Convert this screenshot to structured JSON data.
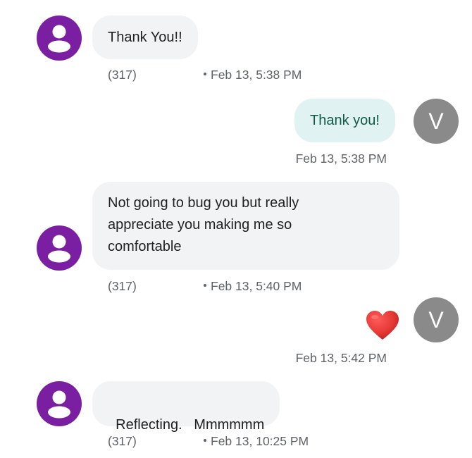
{
  "colors": {
    "incoming_avatar": "#7b1fa2",
    "outgoing_avatar": "#8a8a8a",
    "incoming_bubble": "#f1f3f4",
    "outgoing_bubble": "#e0f2f1",
    "outgoing_text": "#0d5c45",
    "heart": "#e53935"
  },
  "icons": {
    "incoming_avatar": "person-icon",
    "reaction": "heart-icon"
  },
  "messages": [
    {
      "direction": "incoming",
      "text": "Thank You!!",
      "sender": "(317)",
      "timestamp": "Feb 13, 5:38 PM"
    },
    {
      "direction": "outgoing",
      "text": "Thank you!",
      "avatar_letter": "V",
      "timestamp": "Feb 13, 5:38 PM"
    },
    {
      "direction": "incoming",
      "lines": [
        "Not going to bug you but really",
        "appreciate you making me so",
        "comfortable"
      ],
      "sender": "(317)",
      "timestamp": "Feb 13, 5:40 PM"
    },
    {
      "direction": "outgoing",
      "emoji": "heart",
      "avatar_letter": "V",
      "timestamp": "Feb 13, 5:42 PM"
    },
    {
      "direction": "incoming",
      "text": "Reflecting.   Mmmmmm",
      "sender": "(317)",
      "timestamp": "Feb 13, 10:25 PM"
    }
  ]
}
